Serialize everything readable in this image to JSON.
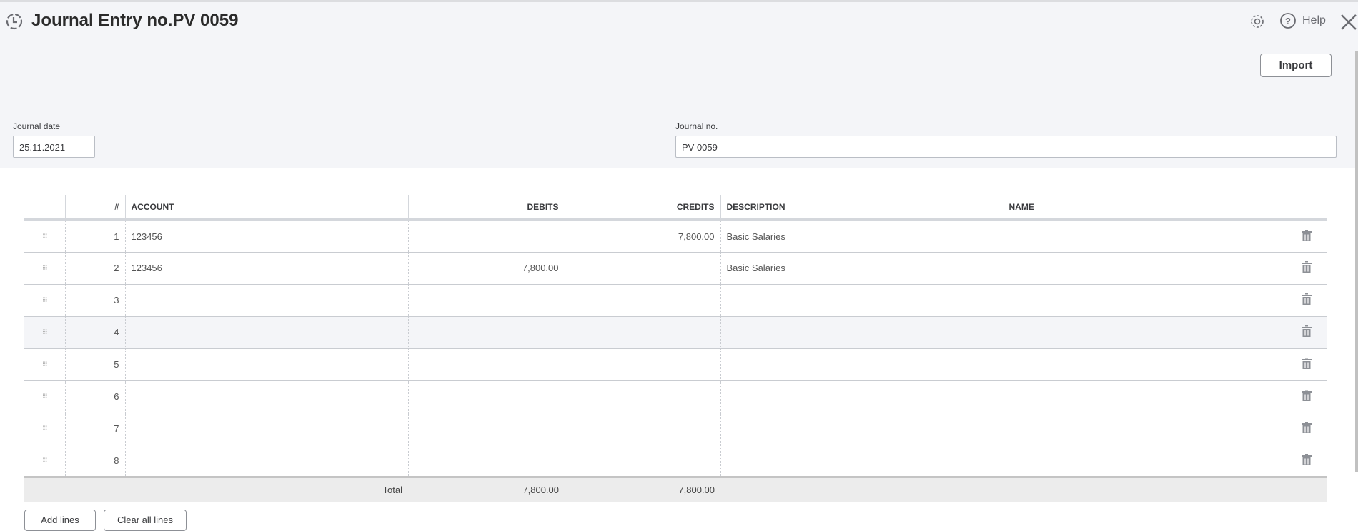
{
  "header": {
    "title": "Journal Entry no.PV 0059",
    "help_label": "Help",
    "import_label": "Import"
  },
  "form": {
    "journal_date_label": "Journal date",
    "journal_date_value": "25.11.2021",
    "journal_no_label": "Journal no.",
    "journal_no_value": "PV 0059"
  },
  "table": {
    "columns": [
      "#",
      "ACCOUNT",
      "DEBITS",
      "CREDITS",
      "DESCRIPTION",
      "NAME"
    ],
    "rows": [
      {
        "n": "1",
        "account": "123456",
        "debits": "",
        "credits": "7,800.00",
        "description": "Basic Salaries",
        "name": ""
      },
      {
        "n": "2",
        "account": "123456",
        "debits": "7,800.00",
        "credits": "",
        "description": "Basic Salaries",
        "name": ""
      },
      {
        "n": "3",
        "account": "",
        "debits": "",
        "credits": "",
        "description": "",
        "name": ""
      },
      {
        "n": "4",
        "account": "",
        "debits": "",
        "credits": "",
        "description": "",
        "name": ""
      },
      {
        "n": "5",
        "account": "",
        "debits": "",
        "credits": "",
        "description": "",
        "name": ""
      },
      {
        "n": "6",
        "account": "",
        "debits": "",
        "credits": "",
        "description": "",
        "name": ""
      },
      {
        "n": "7",
        "account": "",
        "debits": "",
        "credits": "",
        "description": "",
        "name": ""
      },
      {
        "n": "8",
        "account": "",
        "debits": "",
        "credits": "",
        "description": "",
        "name": ""
      }
    ],
    "total_label": "Total",
    "total_debits": "7,800.00",
    "total_credits": "7,800.00"
  },
  "actions": {
    "add_lines": "Add lines",
    "clear_all_lines": "Clear all lines"
  }
}
